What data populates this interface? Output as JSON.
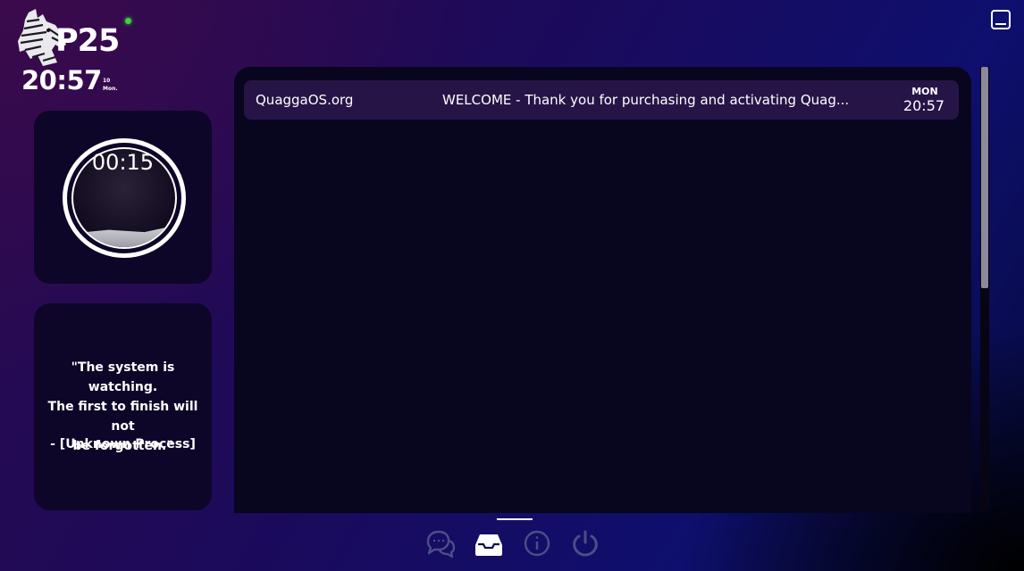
{
  "header": {
    "brand": "P25",
    "clock": "20:57",
    "clock_meta_line1": "10",
    "clock_meta_line2": "Mon."
  },
  "timer": {
    "value": "00:15",
    "fill_fraction": 0.22
  },
  "quote": {
    "line1": "\"The system is watching.",
    "line2": "The first to finish will not",
    "line3": "be forgotten.\"",
    "author": "- [Unknown Process]"
  },
  "inbox": {
    "messages": [
      {
        "sender": "QuaggaOS.org",
        "subject": "WELCOME - Thank you for purchasing and activating Quag...",
        "day": "MON",
        "time": "20:57"
      }
    ]
  },
  "nav": {
    "items": [
      {
        "icon": "chat-bubbles-icon",
        "active": false
      },
      {
        "icon": "inbox-tray-icon",
        "active": true
      },
      {
        "icon": "info-icon",
        "active": false
      },
      {
        "icon": "power-icon",
        "active": false
      }
    ]
  },
  "colors": {
    "status_dot": "#3bd33b",
    "panel_bg": "#08051e",
    "message_row_bg": "#261447",
    "nav_inactive": "#4a4f86"
  },
  "scroll": {
    "position_fraction": 0.0,
    "visible_fraction": 0.5
  }
}
